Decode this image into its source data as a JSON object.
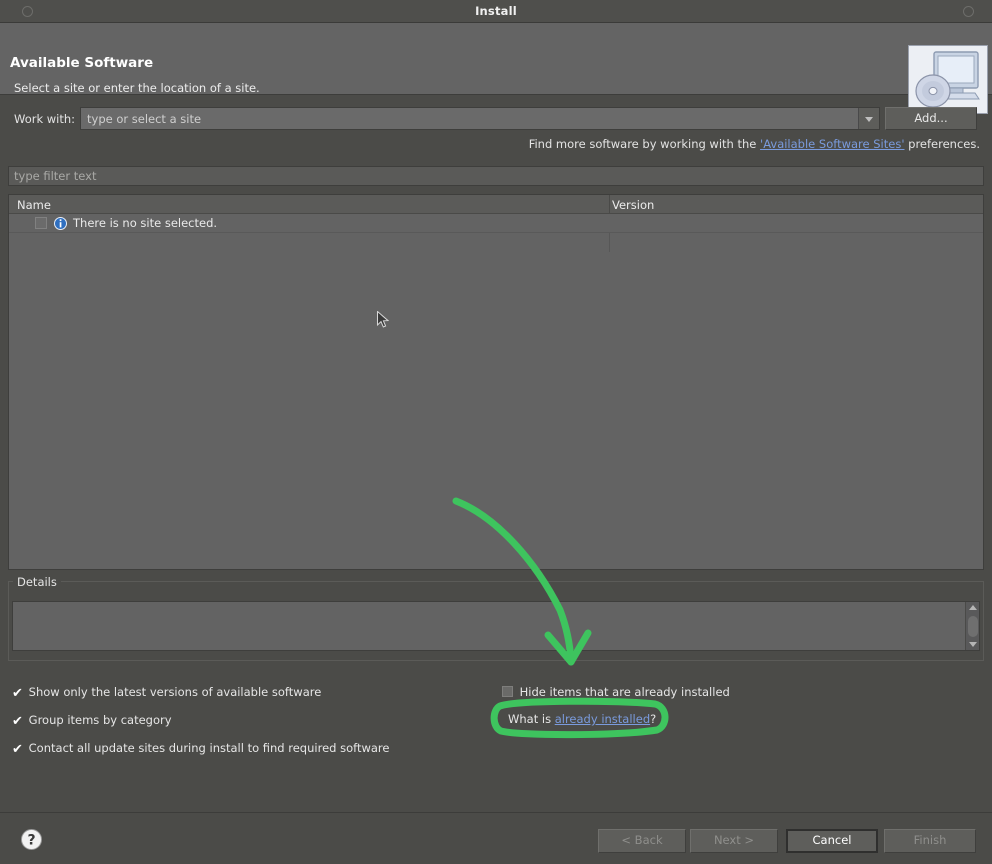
{
  "window": {
    "title": "Install",
    "left_button_icon": "window-menu-icon",
    "right_button_icon": "window-close-icon"
  },
  "banner": {
    "title": "Available Software",
    "subtitle": "Select a site or enter the location of a site.",
    "icon": "install-monitor-disc-icon"
  },
  "work_with": {
    "label": "Work with:",
    "value": "",
    "placeholder": "type or select a site",
    "dropdown_icon": "chevron-down-icon",
    "add_label": "Add..."
  },
  "find_more": {
    "prefix": "Find more software by working with the",
    "link": "'Available Software Sites'",
    "suffix": "preferences."
  },
  "filter": {
    "value": "",
    "placeholder": "type filter text"
  },
  "table": {
    "columns": [
      "Name",
      "Version"
    ],
    "rows": [
      {
        "checked": false,
        "icon": "info-icon",
        "name": "There is no site selected.",
        "version": ""
      }
    ]
  },
  "details": {
    "label": "Details",
    "content": "",
    "scrollbar": {
      "up_icon": "scroll-up-icon",
      "down_icon": "scroll-down-icon"
    }
  },
  "options": [
    {
      "label": "Show only the latest versions of available software",
      "checked": true
    },
    {
      "label": "Group items by category",
      "checked": true
    },
    {
      "label": "Contact all update sites during install to find required software",
      "checked": true
    },
    {
      "label": "Hide items that are already installed",
      "checked": false
    }
  ],
  "what_is": {
    "prefix": "What is",
    "link": "already installed",
    "suffix": "?"
  },
  "buttons": {
    "help_icon": "help-question-icon",
    "back": "< Back",
    "next": "Next >",
    "cancel": "Cancel",
    "finish": "Finish"
  },
  "annotations": {
    "color": "#3ec45e",
    "arrow": "curved-arrow-pointing-down-to-what-is-already-installed",
    "ellipse": "highlight-ellipse-around-what-is-already-installed"
  },
  "colors": {
    "dialog_bg": "#4b4b48",
    "banner_bg": "#646464",
    "table_bg": "#636363",
    "link": "#7a9bdd",
    "annotation_green": "#3ec45e"
  }
}
